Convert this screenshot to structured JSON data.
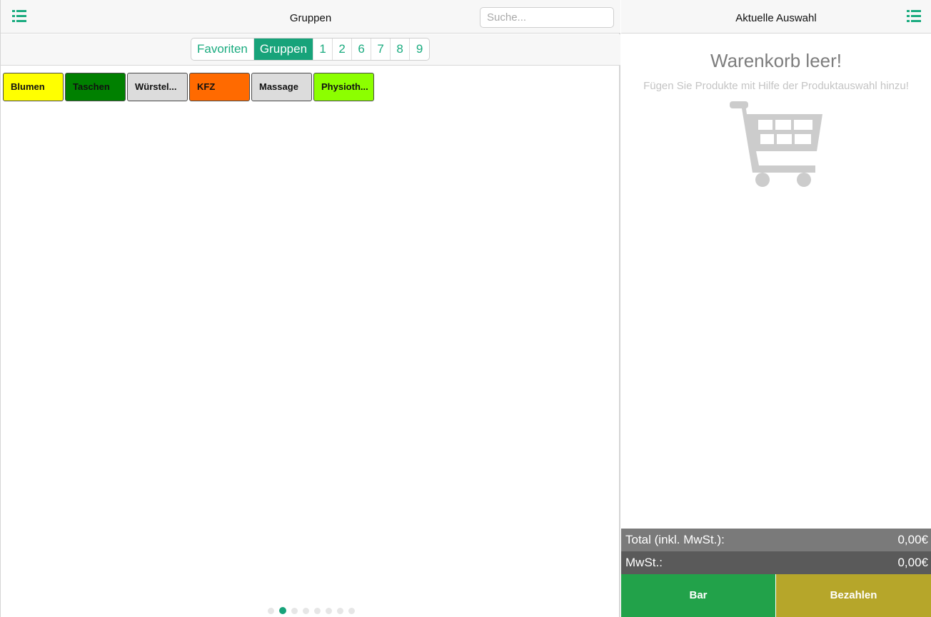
{
  "left": {
    "title": "Gruppen",
    "search_placeholder": "Suche...",
    "menu_icon": "list-icon"
  },
  "tabs": [
    {
      "label": "Favoriten",
      "active": false
    },
    {
      "label": "Gruppen",
      "active": true
    },
    {
      "label": "1",
      "active": false
    },
    {
      "label": "2",
      "active": false
    },
    {
      "label": "6",
      "active": false
    },
    {
      "label": "7",
      "active": false
    },
    {
      "label": "8",
      "active": false
    },
    {
      "label": "9",
      "active": false
    }
  ],
  "groups": [
    {
      "label": "Blumen",
      "color": "#ffff00"
    },
    {
      "label": "Taschen",
      "color": "#008000"
    },
    {
      "label": "Würstel...",
      "color": "#dcdcdc"
    },
    {
      "label": "KFZ",
      "color": "#ff6a00"
    },
    {
      "label": "Massage",
      "color": "#dcdcdc"
    },
    {
      "label": "Physioth...",
      "color": "#8cff00"
    }
  ],
  "pager": {
    "pages": 8,
    "active_index": 1
  },
  "right": {
    "title": "Aktuelle Auswahl",
    "menu_icon": "list-icon",
    "empty_title": "Warenkorb leer!",
    "empty_subtitle": "Fügen Sie Produkte mit Hilfe der Produktauswahl hinzu!",
    "cart_icon": "shopping-cart-icon"
  },
  "summary": {
    "total_label": "Total (inkl. MwSt.):",
    "total_value": "0,00€",
    "tax_label": "MwSt.:",
    "tax_value": "0,00€"
  },
  "buttons": {
    "bar_label": "Bar",
    "pay_label": "Bezahlen"
  },
  "colors": {
    "accent": "#17a37a",
    "bar_button": "#22a24a",
    "pay_button": "#b6a62a"
  }
}
